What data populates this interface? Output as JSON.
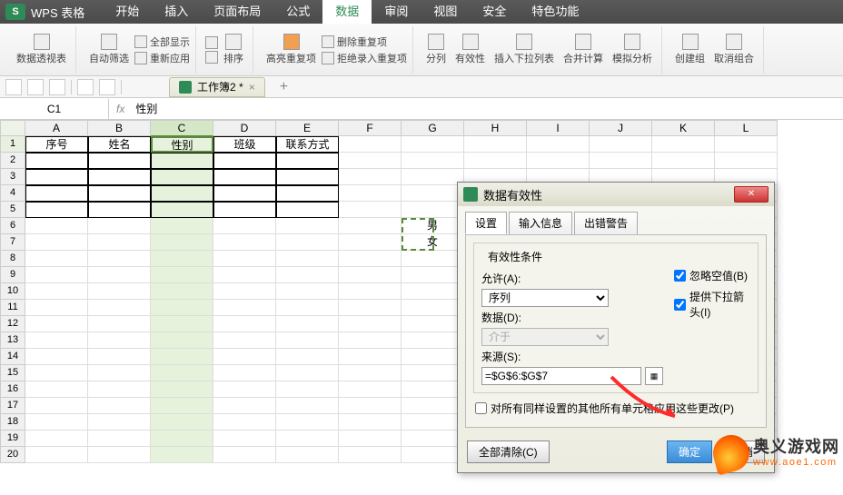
{
  "app": {
    "title": "WPS 表格",
    "logo": "S"
  },
  "menus": [
    "开始",
    "插入",
    "页面布局",
    "公式",
    "数据",
    "审阅",
    "视图",
    "安全",
    "特色功能"
  ],
  "activeMenu": 4,
  "ribbon": {
    "pivot": "数据透视表",
    "autofilter": "自动筛选",
    "showall": "全部显示",
    "reapply": "重新应用",
    "sort": "排序",
    "highlight": "高亮重复项",
    "deldup": "删除重复项",
    "rejectdup": "拒绝录入重复项",
    "split": "分列",
    "validity": "有效性",
    "insertdrop": "插入下拉列表",
    "consolidate": "合并计算",
    "whatif": "模拟分析",
    "group": "创建组",
    "ungroup": "取消组合"
  },
  "doctab": "工作簿2 *",
  "namebox": "C1",
  "formula": "性别",
  "cols": [
    "A",
    "B",
    "C",
    "D",
    "E",
    "F",
    "G",
    "H",
    "I",
    "J",
    "K",
    "L"
  ],
  "headers": [
    "序号",
    "姓名",
    "性别",
    "班级",
    "联系方式"
  ],
  "srcvals": [
    "男",
    "女"
  ],
  "dialog": {
    "title": "数据有效性",
    "tabs": [
      "设置",
      "输入信息",
      "出错警告"
    ],
    "activeTab": 0,
    "group": "有效性条件",
    "allow_label": "允许(A):",
    "allow_val": "序列",
    "data_label": "数据(D):",
    "data_val": "介于",
    "source_label": "来源(S):",
    "source_val": "=$G$6:$G$7",
    "ignore": "忽略空值(B)",
    "dropdown": "提供下拉箭头(I)",
    "applyall": "对所有同样设置的其他所有单元格应用这些更改(P)",
    "clear": "全部清除(C)",
    "ok": "确定",
    "cancel": "取消"
  },
  "watermark": {
    "line1": "奥义游戏网",
    "line2": "www.aoe1.com"
  }
}
